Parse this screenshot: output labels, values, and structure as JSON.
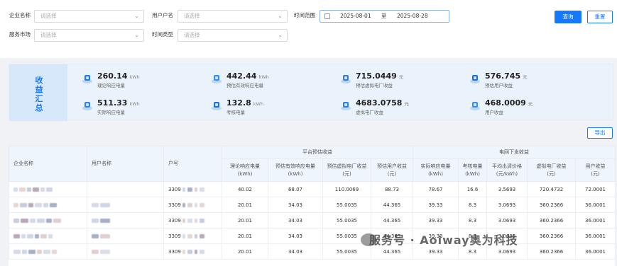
{
  "filters": {
    "company_label": "企业名称",
    "company_placeholder": "请选择",
    "user_label": "用户户名",
    "user_placeholder": "请选择",
    "time_range_label": "时间范围",
    "date_start": "2025-08-01",
    "date_sep": "至",
    "date_end": "2025-08-28",
    "market_label": "服务市场",
    "market_placeholder": "请选择",
    "time_type_label": "时间类型",
    "time_type_placeholder": "请选择",
    "query_button": "查询",
    "reset_button": "重置"
  },
  "summary": {
    "title_chars": [
      "收",
      "益",
      "汇",
      "总"
    ],
    "stats": [
      {
        "value": "260.14",
        "unit": "kWh",
        "label": "理论响应电量",
        "icon": "lightning-drop-icon"
      },
      {
        "value": "442.44",
        "unit": "kWh",
        "label": "预估有效响应电量",
        "icon": "layers-icon"
      },
      {
        "value": "715.0449",
        "unit": "元",
        "label": "预估虚拟电厂收益",
        "icon": "coin-stack-icon"
      },
      {
        "value": "576.745",
        "unit": "元",
        "label": "预估用户收益",
        "icon": "user-wallet-icon"
      },
      {
        "value": "511.33",
        "unit": "kWh",
        "label": "实际响应电量",
        "icon": "meter-icon"
      },
      {
        "value": "132.8",
        "unit": "kWh",
        "label": "考核电量",
        "icon": "check-gauge-icon"
      },
      {
        "value": "4683.0758",
        "unit": "元",
        "label": "虚拟电厂收益",
        "icon": "hand-coin-icon"
      },
      {
        "value": "468.0009",
        "unit": "元",
        "label": "用户收益",
        "icon": "user-coin-icon"
      }
    ]
  },
  "export_button": "导出",
  "table": {
    "group_headers": [
      "平台预估收益",
      "电网下发收益"
    ],
    "col_company": "企业名称",
    "col_user": "用户名称",
    "col_account": "户号",
    "platform_cols": [
      "理论响应电量\n(kWh)",
      "预估有效响应电量\n(kWh)",
      "预估虚拟电厂收益\n(元)",
      "预估用户收益\n(元)"
    ],
    "grid_cols": [
      "实际响应电量\n(kWh)",
      "考核电量\n(kWh)",
      "平均出清价格\n(元/kWh)",
      "虚拟电厂收益\n(元)",
      "用户收益\n(元)"
    ],
    "rows": [
      {
        "account": "3309",
        "v": [
          "40.02",
          "68.07",
          "110.0069",
          "88.73",
          "78.67",
          "16.6",
          "3.5693",
          "720.4732",
          "72.0001"
        ]
      },
      {
        "account": "3309",
        "v": [
          "20.01",
          "34.03",
          "55.0035",
          "44.365",
          "39.33",
          "8.3",
          "3.0693",
          "360.2366",
          "36.0001"
        ]
      },
      {
        "account": "3309",
        "v": [
          "20.01",
          "34.03",
          "55.0035",
          "44.365",
          "39.33",
          "8.3",
          "3.0693",
          "360.2366",
          "36.0001"
        ]
      },
      {
        "account": "3309",
        "v": [
          "20.01",
          "34.03",
          "55.0035",
          "44.365",
          "39.33",
          "8.3",
          "3.0693",
          "360.2366",
          "36.0001"
        ]
      },
      {
        "account": "3309",
        "v": [
          "20.01",
          "34.03",
          "55.0035",
          "44.365",
          "39.33",
          "8.3",
          "3.0693",
          "360.2366",
          "36.0001"
        ]
      }
    ]
  },
  "watermark": "服务号 · Aoiway奥为科技",
  "colors": {
    "primary": "#1677ff",
    "summary_bg": "#eaf3fc",
    "header_bg": "#eef5fd"
  }
}
